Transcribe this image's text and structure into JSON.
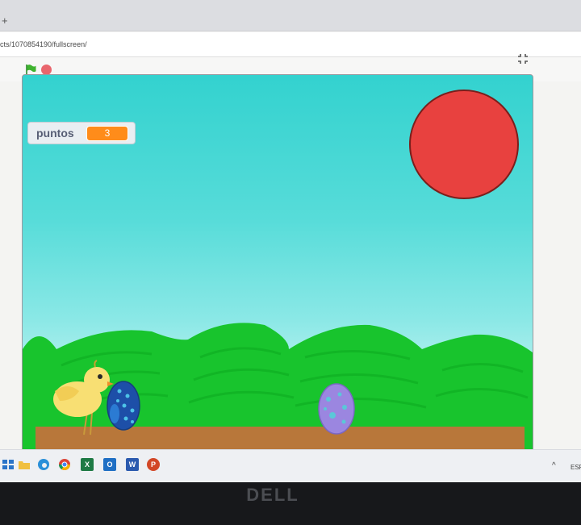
{
  "browser": {
    "new_tab_glyph": "+",
    "url": "cts/1070854190/fullscreen/"
  },
  "player": {
    "green_flag_icon": "green-flag-icon",
    "stop_icon": "stop-icon",
    "fullscreen_icon": "exit-fullscreen-icon"
  },
  "stage": {
    "variable_monitor": {
      "label": "puntos",
      "value": "3"
    },
    "colors": {
      "sky_top": "#33d2cf",
      "sky_bottom": "#bff2f0",
      "hills": "#16c82c",
      "ground": "#b8773a",
      "sun": "#e8413f"
    },
    "sprites": [
      "chick",
      "blue-spotted-egg",
      "purple-spotted-egg",
      "red-sun"
    ]
  },
  "taskbar": {
    "icons": [
      "windows-start-icon",
      "file-explorer-icon",
      "edge-icon",
      "chrome-icon",
      "excel-icon",
      "outlook-icon",
      "word-icon",
      "powerpoint-icon"
    ],
    "excel_letter": "X",
    "outlook_letter": "O",
    "word_letter": "W",
    "powerpoint_letter": "P",
    "tray_chevron": "^",
    "language": "ESP"
  },
  "monitor_brand": "DELL"
}
